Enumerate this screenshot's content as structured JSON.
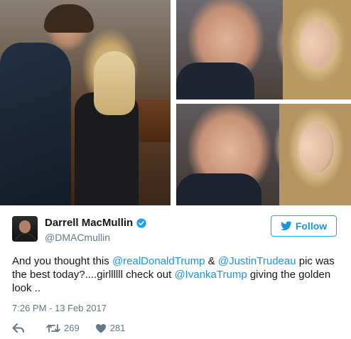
{
  "tweet": {
    "author": {
      "display_name": "Darrell MacMullin",
      "handle": "@DMACmullin",
      "verified": true
    },
    "follow_label": "Follow",
    "text_segments": [
      {
        "text": "And you thought this ",
        "type": "text"
      },
      {
        "text": "@realDonaldTrump",
        "type": "mention"
      },
      {
        "text": " & ",
        "type": "text"
      },
      {
        "text": "@JustinTrudeau",
        "type": "mention"
      },
      {
        "text": " pic was the best today?....girllllll check out ",
        "type": "text"
      },
      {
        "text": "@IvankaTrump",
        "type": "mention"
      },
      {
        "text": " giving the golden look ..",
        "type": "text"
      }
    ],
    "timestamp": "7:26 PM - 13 Feb 2017",
    "retweets": "269",
    "likes": "281"
  },
  "icons": {
    "verified": "verified-badge-icon",
    "follow": "twitter-bird-icon",
    "reply": "reply-icon",
    "retweet": "retweet-icon",
    "like": "heart-icon"
  },
  "colors": {
    "accent": "#1b95e0",
    "muted": "#657786",
    "text": "#14171a"
  }
}
